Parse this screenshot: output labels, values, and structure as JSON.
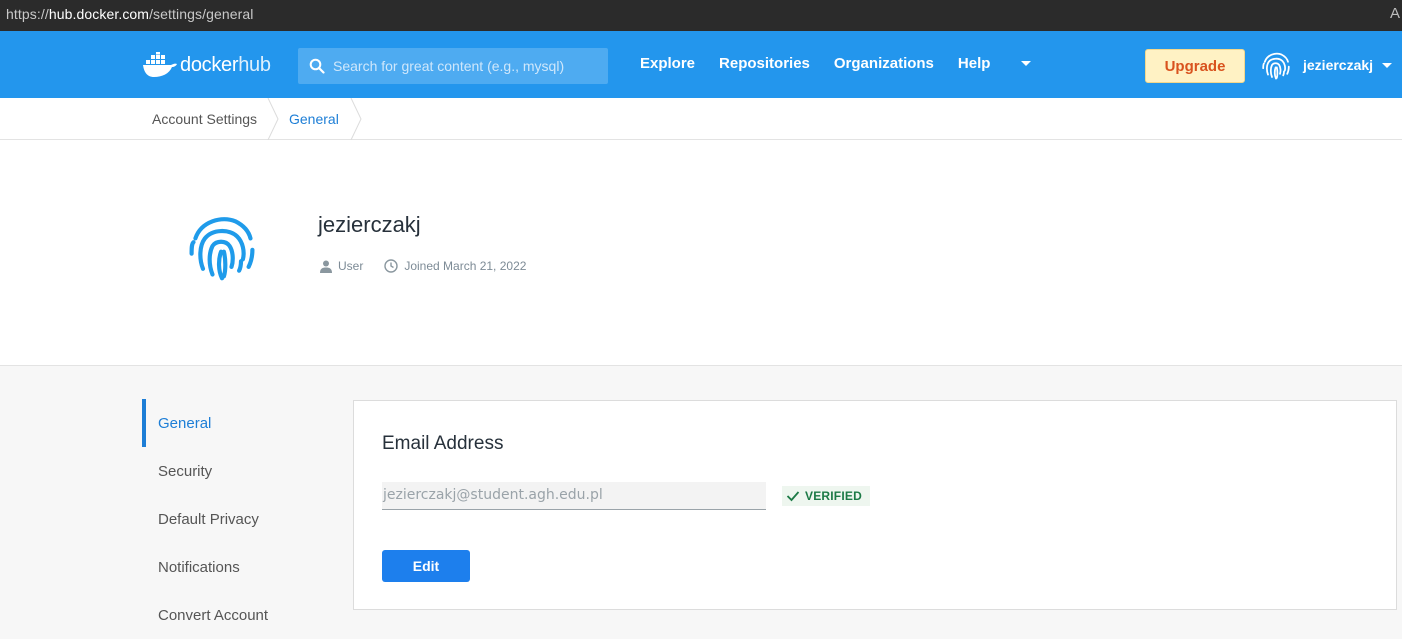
{
  "browser": {
    "url_prefix": "https://",
    "url_host": "hub.docker.com",
    "url_path": "/settings/general",
    "reader_icon": "A"
  },
  "navbar": {
    "brand_docker": "docker",
    "brand_hub": "hub",
    "search_placeholder": "Search for great content (e.g., mysql)",
    "links": {
      "explore": "Explore",
      "repositories": "Repositories",
      "organizations": "Organizations",
      "help": "Help"
    },
    "upgrade_label": "Upgrade",
    "username": "jezierczakj",
    "colors": {
      "bar": "#2396ed",
      "upgrade_text": "#d9531e"
    }
  },
  "breadcrumb": {
    "items": [
      "Account Settings",
      "General"
    ]
  },
  "profile": {
    "name": "jezierczakj",
    "role": "User",
    "joined": "Joined March 21, 2022"
  },
  "sidebar": {
    "items": [
      "General",
      "Security",
      "Default Privacy",
      "Notifications",
      "Convert Account"
    ],
    "active": "General"
  },
  "email_card": {
    "title": "Email Address",
    "email_value": "jezierczakj@student.agh.edu.pl",
    "status_badge": "VERIFIED",
    "edit_label": "Edit"
  }
}
